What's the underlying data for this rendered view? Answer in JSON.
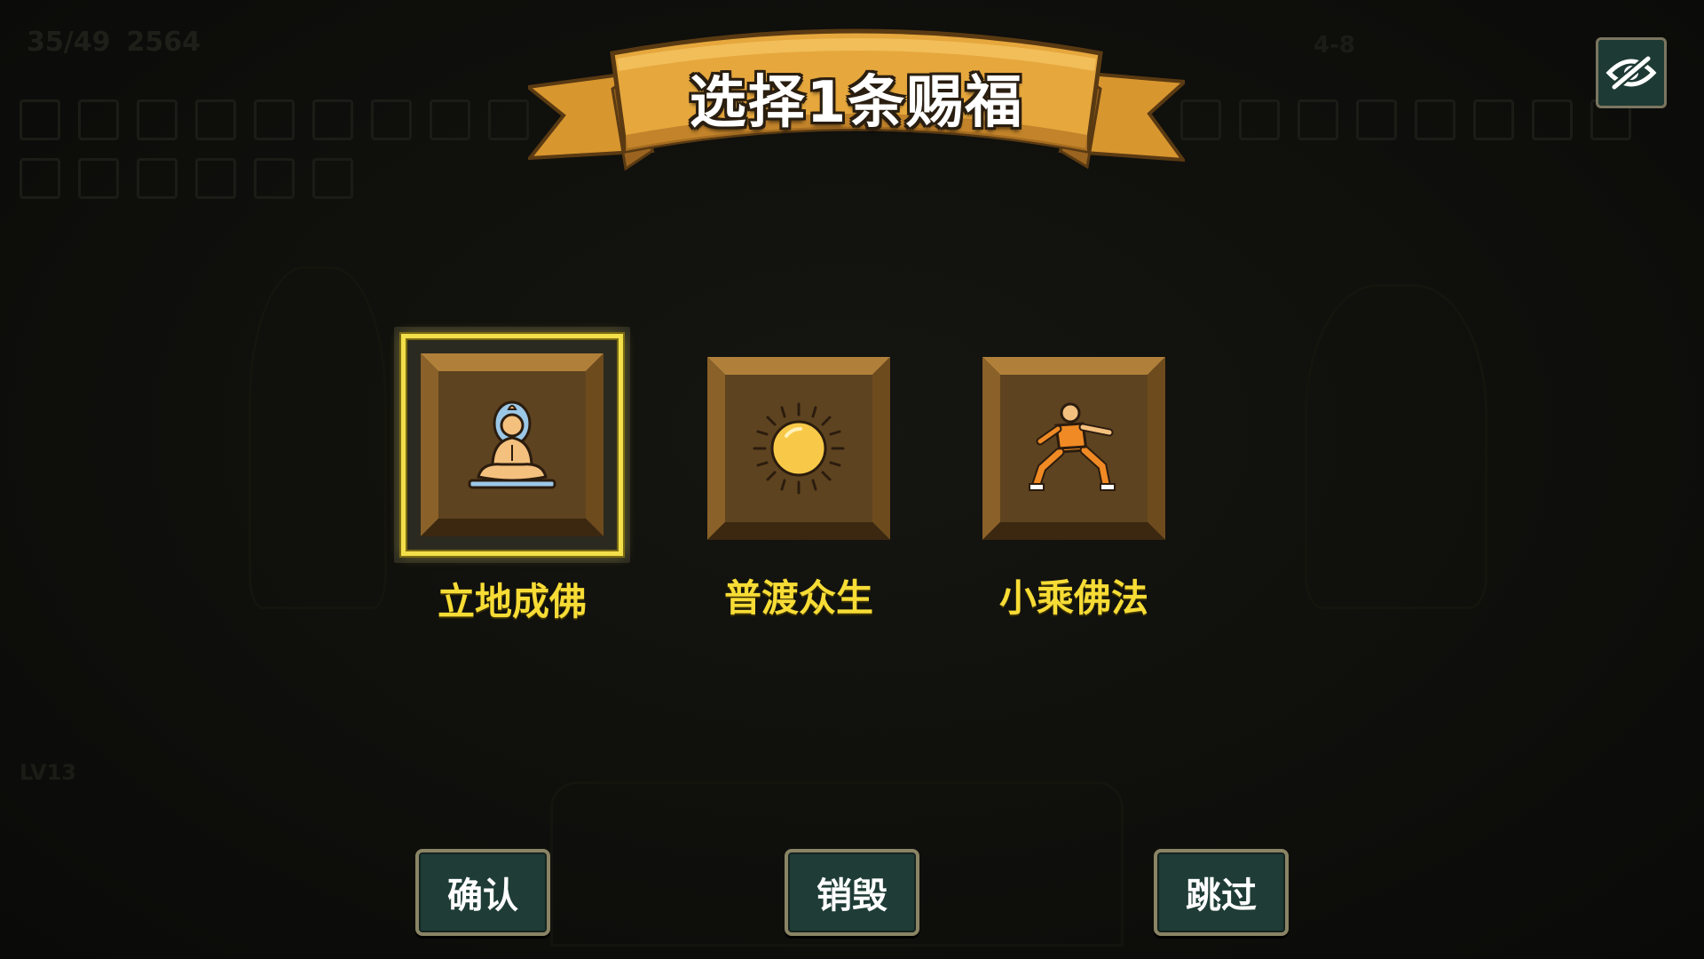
{
  "hud": {
    "hp": "35/49",
    "gold": "2564",
    "stage": "4-8",
    "level": "LV13"
  },
  "banner": {
    "title": "选择1条赐福"
  },
  "hide_toggle": {
    "icon": "eye-slash-icon"
  },
  "blessings": [
    {
      "label": "立地成佛",
      "icon": "meditating-buddha-icon",
      "selected": true
    },
    {
      "label": "普渡众生",
      "icon": "sun-icon",
      "selected": false
    },
    {
      "label": "小乘佛法",
      "icon": "kungfu-monk-icon",
      "selected": false
    }
  ],
  "buttons": {
    "confirm": "确认",
    "destroy": "销毁",
    "skip": "跳过"
  },
  "colors": {
    "label_yellow": "#f7dc36",
    "selection_border": "#f3df4a",
    "button_bg": "#1f3c36",
    "tile_brown": "#5e4320",
    "ribbon_gold": "#e0a03a"
  }
}
